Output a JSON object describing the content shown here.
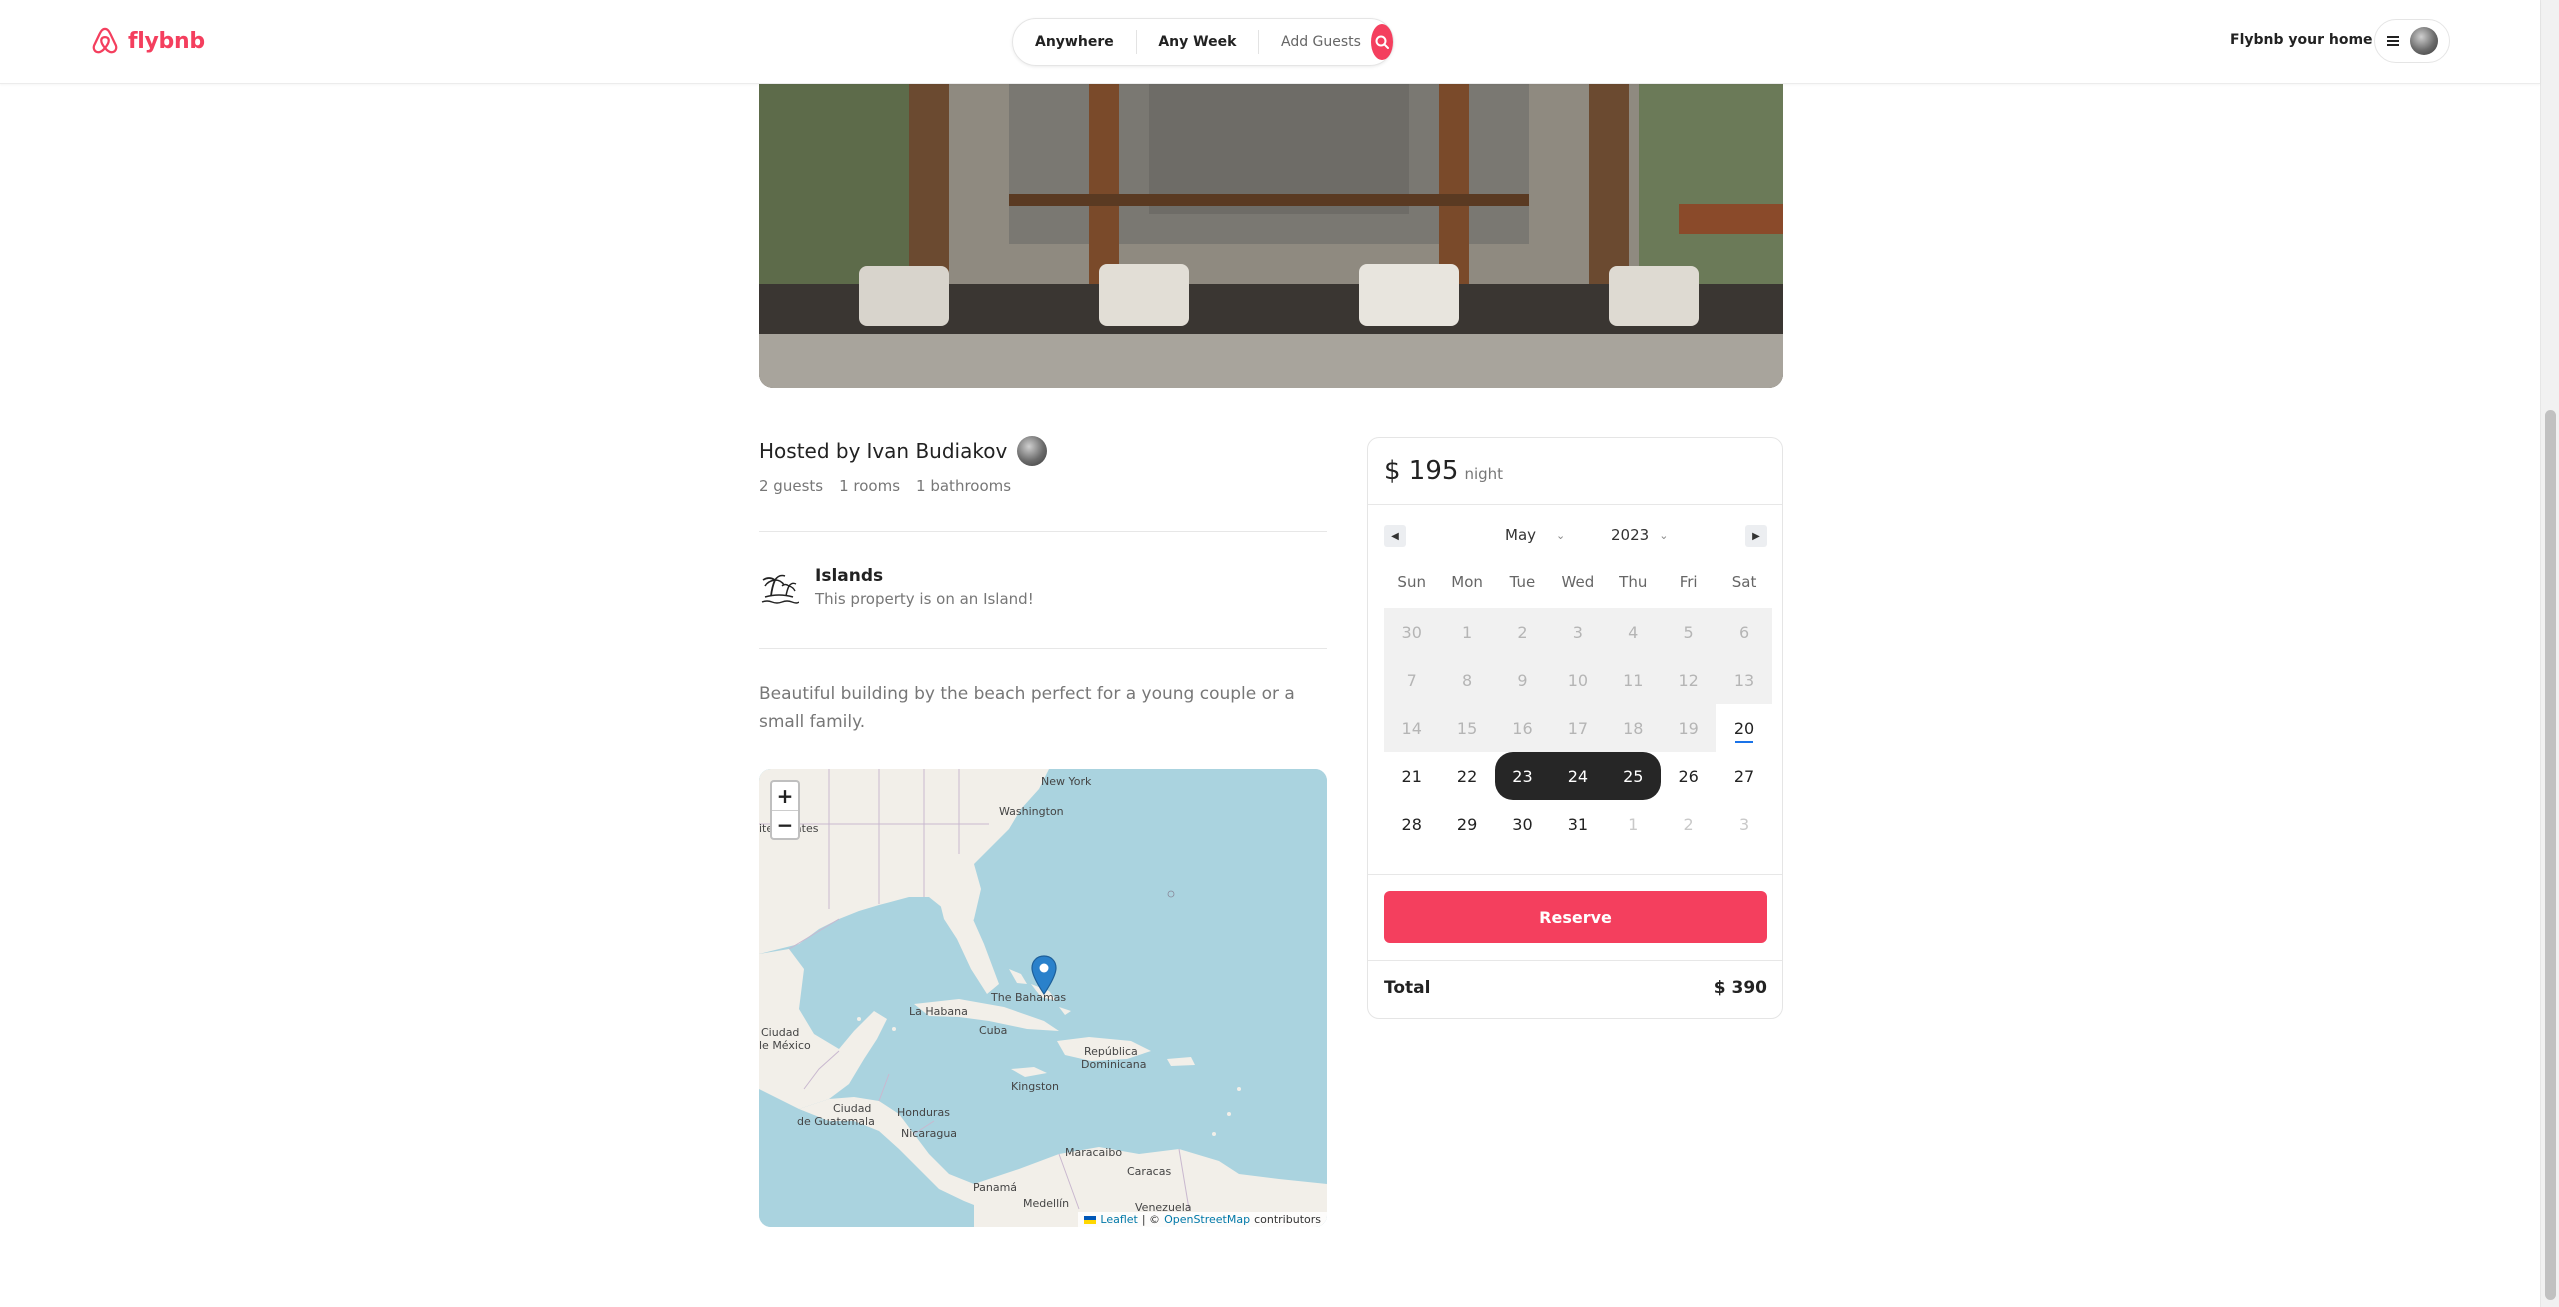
{
  "header": {
    "brand": "flybnb",
    "search": {
      "location": "Anywhere",
      "week": "Any Week",
      "guests": "Add Guests"
    },
    "host_link": "Flybnb your home"
  },
  "listing": {
    "host_prefix": "Hosted by",
    "host_name": "Ivan Budiakov",
    "guests": "2 guests",
    "rooms": "1 rooms",
    "bathrooms": "1 bathrooms",
    "category": {
      "name": "Islands",
      "description": "This property is on an Island!",
      "icon": "islands-icon"
    },
    "description": "Beautiful building by the beach perfect for a young couple or a small family."
  },
  "map": {
    "zoom_in": "+",
    "zoom_out": "−",
    "labels": {
      "new_york": "New York",
      "washington": "Washington",
      "united_states": "ited States",
      "bahamas": "The Bahamas",
      "la_habana": "La Habana",
      "cuba": "Cuba",
      "rep_dom_1": "República",
      "rep_dom_2": "Dominicana",
      "ciudad_mexico_1": "Ciudad",
      "ciudad_mexico_2": "le México",
      "kingston": "Kingston",
      "ciudad_guatemala_1": "Ciudad",
      "ciudad_guatemala_2": "de Guatemala",
      "honduras": "Honduras",
      "nicaragua": "Nicaragua",
      "maracaibo": "Maracaibo",
      "caracas": "Caracas",
      "panama": "Panamá",
      "venezuela": "Venezuela",
      "medellin": "Medellín"
    },
    "attribution": {
      "leaflet": "Leaflet",
      "separator": "| ©",
      "osm": "OpenStreetMap",
      "suffix": "contributors"
    }
  },
  "booking": {
    "price": "$ 195",
    "unit": "night",
    "month": "May",
    "year": "2023",
    "weekdays": [
      "Sun",
      "Mon",
      "Tue",
      "Wed",
      "Thu",
      "Fri",
      "Sat"
    ],
    "days": [
      {
        "d": "30",
        "s": "past"
      },
      {
        "d": "1",
        "s": "past"
      },
      {
        "d": "2",
        "s": "past"
      },
      {
        "d": "3",
        "s": "past"
      },
      {
        "d": "4",
        "s": "past"
      },
      {
        "d": "5",
        "s": "past"
      },
      {
        "d": "6",
        "s": "past"
      },
      {
        "d": "7",
        "s": "past"
      },
      {
        "d": "8",
        "s": "past"
      },
      {
        "d": "9",
        "s": "past"
      },
      {
        "d": "10",
        "s": "past"
      },
      {
        "d": "11",
        "s": "past"
      },
      {
        "d": "12",
        "s": "past"
      },
      {
        "d": "13",
        "s": "past"
      },
      {
        "d": "14",
        "s": "past"
      },
      {
        "d": "15",
        "s": "past"
      },
      {
        "d": "16",
        "s": "past"
      },
      {
        "d": "17",
        "s": "past"
      },
      {
        "d": "18",
        "s": "past"
      },
      {
        "d": "19",
        "s": "past"
      },
      {
        "d": "20",
        "s": "today"
      },
      {
        "d": "21",
        "s": ""
      },
      {
        "d": "22",
        "s": ""
      },
      {
        "d": "23",
        "s": "sel sel-start"
      },
      {
        "d": "24",
        "s": "sel"
      },
      {
        "d": "25",
        "s": "sel sel-end"
      },
      {
        "d": "26",
        "s": ""
      },
      {
        "d": "27",
        "s": ""
      },
      {
        "d": "28",
        "s": ""
      },
      {
        "d": "29",
        "s": ""
      },
      {
        "d": "30",
        "s": ""
      },
      {
        "d": "31",
        "s": ""
      },
      {
        "d": "1",
        "s": "out"
      },
      {
        "d": "2",
        "s": "out"
      },
      {
        "d": "3",
        "s": "out"
      }
    ],
    "reserve_label": "Reserve",
    "total_label": "Total",
    "total_value": "$ 390"
  },
  "colors": {
    "brand": "#f43f5e",
    "selected_day": "#262626",
    "today_underline": "#1a73e8",
    "sea": "#aad3df",
    "land": "#f2efe9"
  }
}
